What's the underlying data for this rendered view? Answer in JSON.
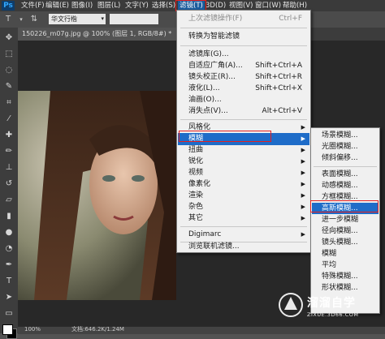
{
  "app": {
    "logo": "Ps"
  },
  "menubar": {
    "items": [
      "文件(F)",
      "编辑(E)",
      "图像(I)",
      "图层(L)",
      "文字(Y)",
      "选择(S)",
      "滤镜(T)",
      "3D(D)",
      "视图(V)",
      "窗口(W)",
      "帮助(H)"
    ],
    "active_index": 6
  },
  "optionsbar": {
    "font": "华文行楷",
    "font_arrow": "▾"
  },
  "document": {
    "tab_title": "150226_m07g.jpg @ 100% (图层 1, RGB/8#) *"
  },
  "status": {
    "zoom": "100%",
    "doc": "文档:646.2K/1.24M"
  },
  "filter_menu": {
    "last_filter": {
      "label": "上次滤镜操作(F)",
      "shortcut": "Ctrl+F"
    },
    "smart": "转换为智能滤镜",
    "group1": [
      {
        "label": "滤镜库(G)...",
        "shortcut": ""
      },
      {
        "label": "自适应广角(A)...",
        "shortcut": "Shift+Ctrl+A"
      },
      {
        "label": "镜头校正(R)...",
        "shortcut": "Shift+Ctrl+R"
      },
      {
        "label": "液化(L)...",
        "shortcut": "Shift+Ctrl+X"
      },
      {
        "label": "油画(O)...",
        "shortcut": ""
      },
      {
        "label": "消失点(V)...",
        "shortcut": "Alt+Ctrl+V"
      }
    ],
    "submenus": [
      "风格化",
      "模糊",
      "扭曲",
      "锐化",
      "视频",
      "像素化",
      "渲染",
      "杂色",
      "其它"
    ],
    "highlighted_submenu": "模糊",
    "digimarc": "Digimarc",
    "browse": "浏览联机滤镜..."
  },
  "blur_menu": {
    "group1": [
      "场景模糊...",
      "光圈模糊...",
      "倾斜偏移..."
    ],
    "group2": [
      "表面模糊...",
      "动感模糊...",
      "方框模糊...",
      "高斯模糊...",
      "进一步模糊",
      "径向模糊...",
      "镜头模糊...",
      "模糊",
      "平均",
      "特殊模糊...",
      "形状模糊..."
    ],
    "highlighted": "高斯模糊..."
  },
  "watermark": {
    "name": "溜溜自学",
    "url": "ZIXUE.3D66.COM"
  },
  "colors": {
    "menu_highlight": "#1e6cc8",
    "annotation_box": "#e32020"
  }
}
